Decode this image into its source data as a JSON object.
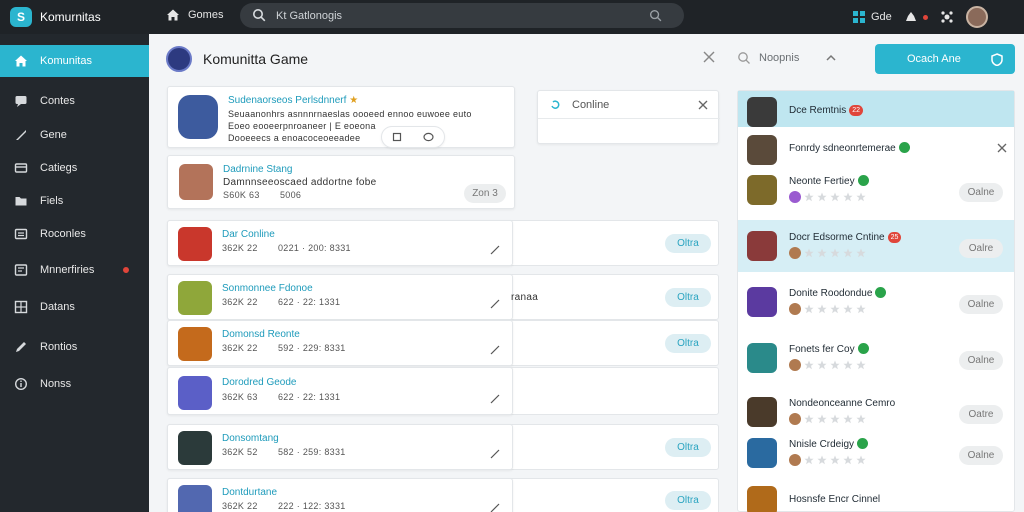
{
  "app": {
    "brand": "Komurnitas",
    "home_label": "Gomes",
    "search_placeholder": "Kt Gatlonogis",
    "top_games_label": "Gde",
    "logo_letter": "S"
  },
  "sidebar": {
    "items": [
      {
        "label": "Komunitas",
        "icon": "home-icon",
        "active": true
      },
      {
        "label": "Contes",
        "icon": "comment-icon"
      },
      {
        "label": "Gene",
        "icon": "controller-icon"
      },
      {
        "label": "Catiegs",
        "icon": "card-icon"
      },
      {
        "label": "Fiels",
        "icon": "folder-icon"
      },
      {
        "label": "Roconles",
        "icon": "list-icon"
      },
      {
        "label": "Mnnerfiries",
        "icon": "flag-icon",
        "badge": true
      },
      {
        "label": "Datans",
        "icon": "grid-icon"
      },
      {
        "label": "Rontios",
        "icon": "edit-icon"
      },
      {
        "label": "Nonss",
        "icon": "info-icon"
      }
    ]
  },
  "header": {
    "title": "Komunitta Game",
    "filter_label": "Noopnis",
    "primary_button": "Ocach Ane"
  },
  "feature_card": {
    "title": "Sudenaorseos Perlsdnnerf",
    "line1": "Seuaanonhrs asnnnrnaeslas oooeed ennoo euwoee euto",
    "line2": "Eoeo eooeerpnroaneer | E eoeona",
    "line3": "Dooeeecs a enoacoceoeeadee"
  },
  "pending_card": {
    "title": "Dadrnine Stang",
    "desc": "Damnnseeoscaed addortne fobe",
    "meta_a": "S60K 63",
    "meta_b": "5006",
    "pill": "Zon 3"
  },
  "online_card": {
    "label": "Conline"
  },
  "stray_text": "ranaa",
  "rows": [
    {
      "title": "Dar Conline",
      "meta_a": "362K 22",
      "meta_b": "0221 · 200: 8331",
      "pill": "Oltra"
    },
    {
      "title": "Sonmonnee Fdonoe",
      "meta_a": "362K 22",
      "meta_b": "622 · 22: 1331",
      "pill": "Oltra"
    },
    {
      "title": "Domonsd Reonte",
      "meta_a": "362K 22",
      "meta_b": "592 · 229: 8331",
      "pill": "Oltra"
    },
    {
      "title": "Dorodred Geode",
      "meta_a": "362K 63",
      "meta_b": "622 · 22: 1331",
      "pill": ""
    },
    {
      "title": "Donsomtang",
      "meta_a": "362K 52",
      "meta_b": "582 · 259: 8331",
      "pill": "Oltra"
    },
    {
      "title": "Dontdurtane",
      "meta_a": "362K 22",
      "meta_b": "222 · 122: 3331",
      "pill": "Oltra"
    }
  ],
  "right_list": [
    {
      "title": "Dce Remtnis",
      "hot": "22"
    },
    {
      "title": "Fonrdy sdneonrtemerae",
      "verified": true,
      "close": true
    },
    {
      "title": "Neonte Fertiey",
      "verified": true,
      "pill": "Oalne"
    },
    {
      "title": "Docr Edsorme Cntine",
      "hot": "25",
      "pill": "Oalre"
    },
    {
      "title": "Donite Roodondue",
      "verified": true,
      "pill": "Oalne"
    },
    {
      "title": "Fonets fer Coy",
      "verified": true,
      "pill": "Oalne"
    },
    {
      "title": "Nondeonceanne Cemro",
      "pill": "Oatre"
    },
    {
      "title": "Nnisle Crdeigy",
      "verified": true,
      "pill": "Oalne"
    },
    {
      "title": "Hosnsfe Encr Cinnel",
      "pill": ""
    }
  ]
}
